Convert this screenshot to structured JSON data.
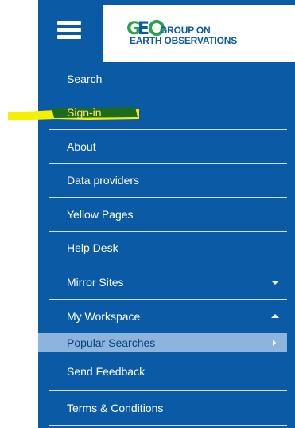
{
  "header": {
    "logo_line1": "GROUP ON",
    "logo_line2": "EARTH OBSERVATIONS"
  },
  "menu": {
    "items": [
      {
        "label": "Search"
      },
      {
        "label": "Sign-in"
      },
      {
        "label": "About"
      },
      {
        "label": "Data providers"
      },
      {
        "label": "Yellow Pages"
      },
      {
        "label": "Help Desk"
      },
      {
        "label": "Mirror Sites"
      },
      {
        "label": "My Workspace"
      },
      {
        "label": "Popular Searches"
      },
      {
        "label": "Send Feedback"
      },
      {
        "label": "Terms & Conditions"
      }
    ]
  },
  "colors": {
    "panel": "#0b5aa6",
    "active": "#8db4dc",
    "highlight_yellow": "#f4f000",
    "highlight_green": "#1e6b1e"
  }
}
